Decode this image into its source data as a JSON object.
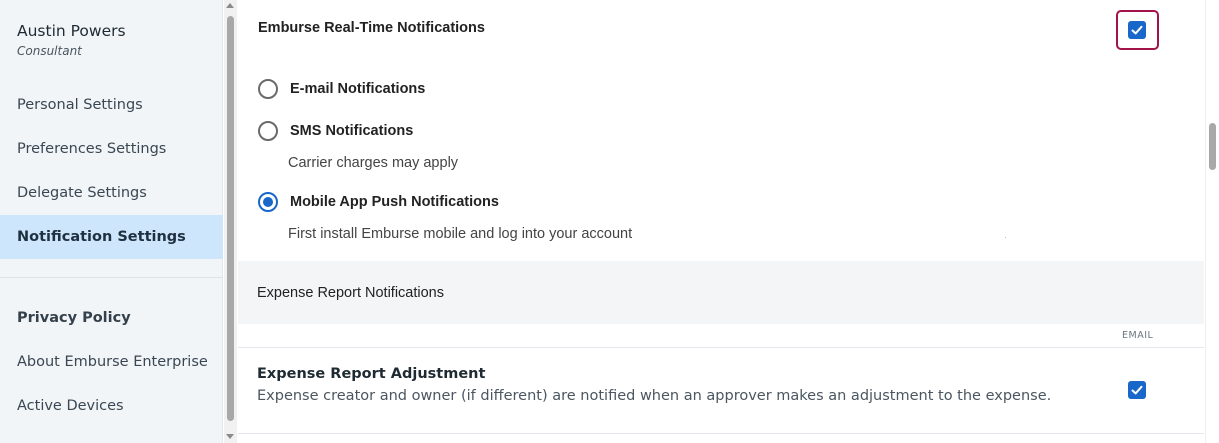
{
  "user": {
    "name": "Austin Powers",
    "role": "Consultant"
  },
  "sidebar": {
    "items": [
      {
        "label": "Personal Settings"
      },
      {
        "label": "Preferences Settings"
      },
      {
        "label": "Delegate Settings"
      },
      {
        "label": "Notification Settings",
        "active": true
      }
    ],
    "secondary": [
      {
        "label": "Privacy Policy"
      },
      {
        "label": "About Emburse Enterprise"
      },
      {
        "label": "Active Devices"
      }
    ]
  },
  "realtime": {
    "title": "Emburse Real-Time Notifications",
    "enabled": true,
    "options": [
      {
        "label": "E-mail Notifications",
        "selected": false
      },
      {
        "label": "SMS Notifications",
        "selected": false,
        "note": "Carrier charges may apply"
      },
      {
        "label": "Mobile App Push Notifications",
        "selected": true,
        "note": "First install Emburse mobile and log into your account"
      }
    ]
  },
  "expense_reports": {
    "title": "Expense Report Notifications",
    "column_header": "EMAIL",
    "rows": [
      {
        "title": "Expense Report Adjustment",
        "description": "Expense creator and owner (if different) are notified when an approver makes an adjustment to the expense.",
        "email": true
      }
    ]
  },
  "colors": {
    "accent": "#1867c9",
    "focus_ring": "#a2134a",
    "active_nav": "#cde6fb"
  },
  "icons": {
    "check": "checkmark-icon",
    "scroll_up": "chevron-up-icon",
    "scroll_down": "chevron-down-icon"
  }
}
